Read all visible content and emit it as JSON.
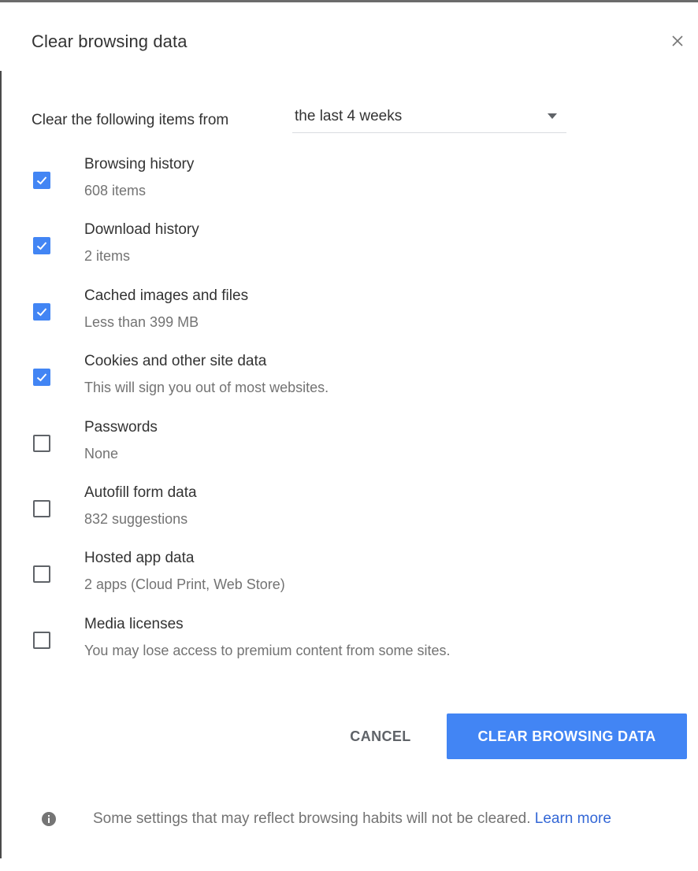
{
  "dialog": {
    "title": "Clear browsing data",
    "close_label": "×"
  },
  "time_range": {
    "label": "Clear the following items from",
    "selected": "the last 4 weeks"
  },
  "options": [
    {
      "title": "Browsing history",
      "subtitle": "608 items",
      "checked": true
    },
    {
      "title": "Download history",
      "subtitle": "2 items",
      "checked": true
    },
    {
      "title": "Cached images and files",
      "subtitle": "Less than 399 MB",
      "checked": true
    },
    {
      "title": "Cookies and other site data",
      "subtitle": "This will sign you out of most websites.",
      "checked": true
    },
    {
      "title": "Passwords",
      "subtitle": "None",
      "checked": false
    },
    {
      "title": "Autofill form data",
      "subtitle": "832 suggestions",
      "checked": false
    },
    {
      "title": "Hosted app data",
      "subtitle": "2 apps (Cloud Print, Web Store)",
      "checked": false
    },
    {
      "title": "Media licenses",
      "subtitle": "You may lose access to premium content from some sites.",
      "checked": false
    }
  ],
  "actions": {
    "cancel_label": "CANCEL",
    "clear_label": "CLEAR BROWSING DATA"
  },
  "footer": {
    "icon": "info-icon",
    "text": "Some settings that may reflect browsing habits will not be cleared.",
    "link_label": "Learn more"
  },
  "colors": {
    "accent": "#4285f4",
    "link": "#3367d6",
    "text_primary": "#333333",
    "text_secondary": "#737373"
  }
}
